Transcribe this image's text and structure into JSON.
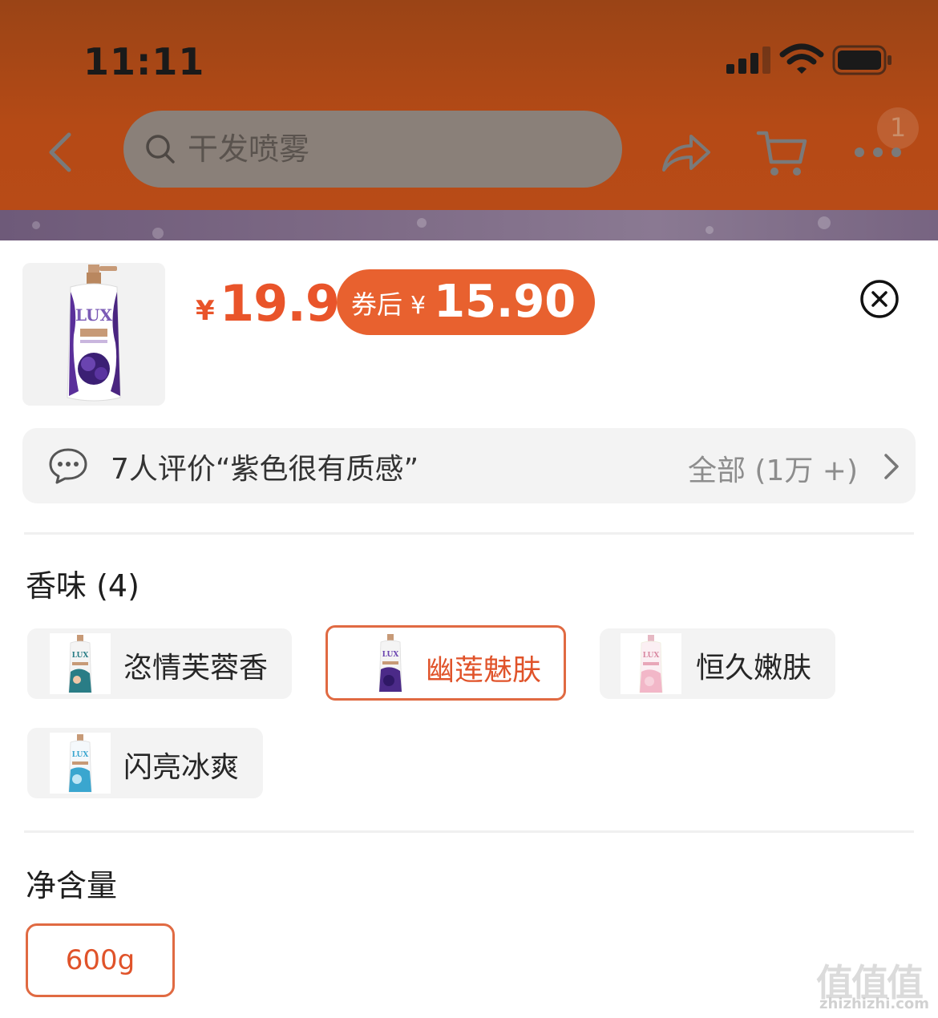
{
  "status_bar": {
    "time": "11:11"
  },
  "nav": {
    "search_placeholder": "干发喷雾",
    "more_badge": "1"
  },
  "product": {
    "price_symbol": "¥",
    "price": "19.9",
    "coupon_label": "券后",
    "coupon_symbol": "¥",
    "coupon_price": "15.90"
  },
  "review": {
    "text": "7人评价“紫色很有质感”",
    "all_label": "全部 (1万 +)"
  },
  "scent": {
    "title": "香味 (4)",
    "options": [
      {
        "label": "恣情芙蓉香",
        "selected": false,
        "color": "#2a7d86"
      },
      {
        "label": "幽莲魅肤",
        "selected": true,
        "color": "#4b2a88"
      },
      {
        "label": "恒久嫩肤",
        "selected": false,
        "color": "#f2b7c8"
      },
      {
        "label": "闪亮冰爽",
        "selected": false,
        "color": "#3aa6cf"
      }
    ]
  },
  "size": {
    "title": "净含量",
    "options": [
      {
        "label": "600g",
        "selected": true
      }
    ]
  },
  "watermark": {
    "chars": "值值值",
    "domain": "zhizhizhi.com"
  },
  "colors": {
    "accent": "#e9542a",
    "coupon_bg": "#e8612f",
    "header_bg": "#b54a16"
  }
}
